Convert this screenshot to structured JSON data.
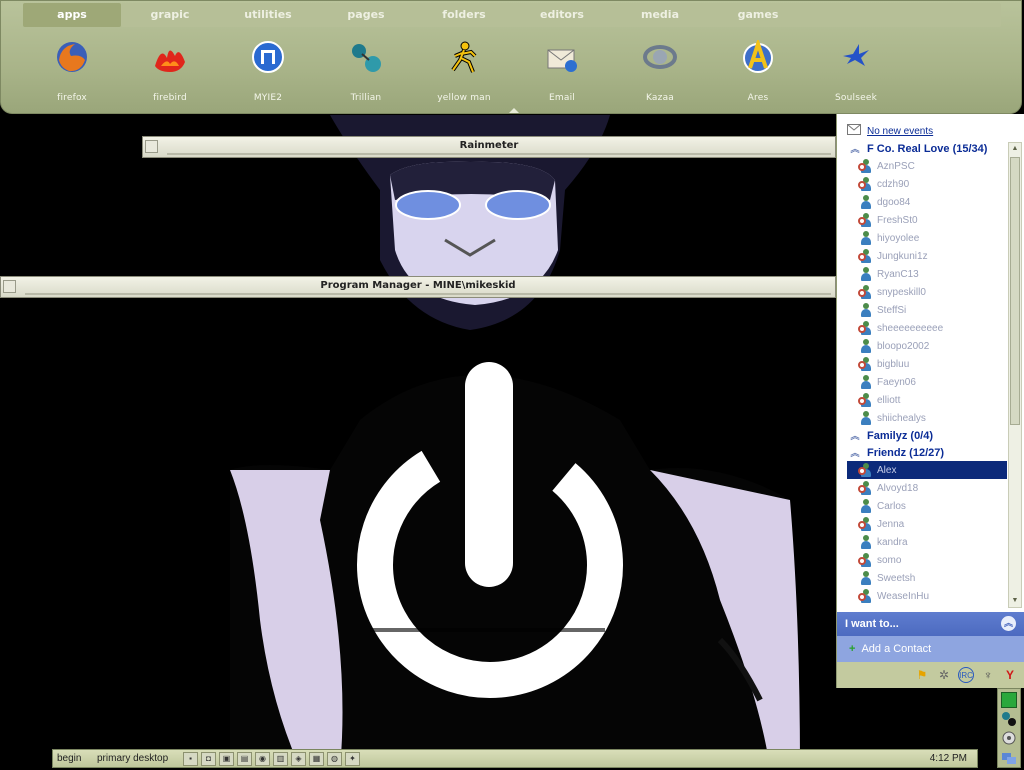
{
  "dock": {
    "tabs": [
      "apps",
      "grapic",
      "utilities",
      "pages",
      "folders",
      "editors",
      "media",
      "games"
    ],
    "active_tab": "apps",
    "items": [
      {
        "label": "firefox",
        "icon": "firefox-icon"
      },
      {
        "label": "firebird",
        "icon": "firebird-icon"
      },
      {
        "label": "MYIE2",
        "icon": "myie2-icon"
      },
      {
        "label": "Trillian",
        "icon": "trillian-icon"
      },
      {
        "label": "yellow man",
        "icon": "aim-running-man-icon"
      },
      {
        "label": "Email",
        "icon": "email-icon"
      },
      {
        "label": "Kazaa",
        "icon": "kazaa-icon"
      },
      {
        "label": "Ares",
        "icon": "ares-icon"
      },
      {
        "label": "Soulseek",
        "icon": "soulseek-bird-icon"
      }
    ]
  },
  "windows": {
    "rainmeter_title": "Rainmeter",
    "program_manager_title": "Program Manager - MINE\\mikeskid"
  },
  "messenger": {
    "events_link": "No new events",
    "groups": [
      {
        "name": "F Co. Real Love (15/34)",
        "contacts": [
          "AznPSC",
          "cdzh90",
          "dgoo84",
          "FreshSt0",
          "hiyoyolee",
          "Jungkuni1z",
          "RyanC13",
          "snypeskill0",
          "SteffSi",
          "sheeeeeeeeee",
          "bloopo2002",
          "bigbluu",
          "Faeyn06",
          "elliott",
          "shiichealys"
        ]
      },
      {
        "name": "Familyz (0/4)",
        "contacts": []
      },
      {
        "name": "Friendz (12/27)",
        "contacts": [
          "Alex",
          "Alvoyd18",
          "Carlos",
          "Jenna",
          "kandra",
          "somo",
          "Sweetsh",
          "WeaseInHu"
        ]
      }
    ],
    "selected_contact": "Alex",
    "i_want_to": "I want to...",
    "add_contact": "Add a Contact",
    "tray_icons": [
      "aim-icon",
      "gear-icon",
      "irc-icon",
      "butterfly-icon",
      "yahoo-icon"
    ]
  },
  "taskbar": {
    "begin": "begin",
    "desktop": "primary desktop",
    "clock": "4:12 PM",
    "quick_icons": [
      "q1",
      "q2",
      "q3",
      "q4",
      "q5",
      "q6",
      "q7",
      "q8",
      "q9",
      "q10"
    ]
  },
  "colors": {
    "dock": "#a9b489",
    "messenger_header": "#4c6ac0",
    "selection": "#0c2a7a"
  }
}
